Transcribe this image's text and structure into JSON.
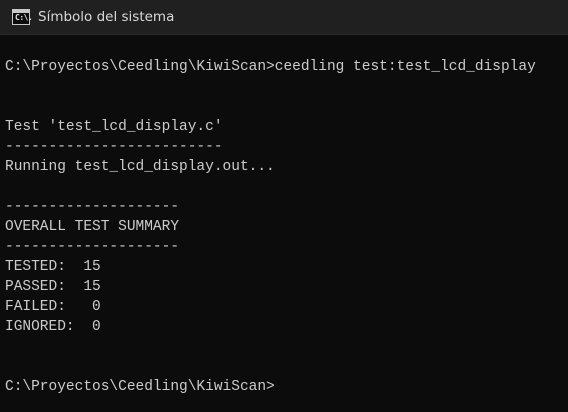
{
  "window": {
    "title": "Símbolo del sistema",
    "icon": "cmd-icon",
    "icon_glyph": "C:\\."
  },
  "console": {
    "lines": [
      "C:\\Proyectos\\Ceedling\\KiwiScan>ceedling test:test_lcd_display",
      "",
      "",
      "Test 'test_lcd_display.c'",
      "-------------------------",
      "Running test_lcd_display.out...",
      "",
      "--------------------",
      "OVERALL TEST SUMMARY",
      "--------------------",
      "TESTED:  15",
      "PASSED:  15",
      "FAILED:   0",
      "IGNORED:  0",
      "",
      "",
      "C:\\Proyectos\\Ceedling\\KiwiScan>"
    ]
  },
  "colors": {
    "background": "#0c0c0c",
    "titlebar": "#202020",
    "text": "#cccccc"
  }
}
